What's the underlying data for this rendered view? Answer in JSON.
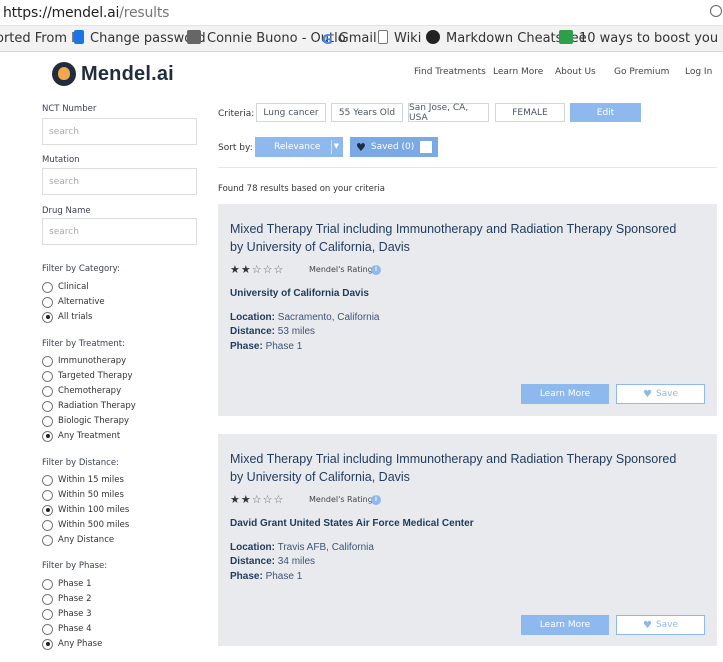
{
  "browser": {
    "url_host": "https://mendel.ai",
    "url_path": "/results",
    "bookmarks": [
      {
        "label": "orted From IE",
        "icon": "none"
      },
      {
        "label": "Change password",
        "icon": "bookmark-blue-icon"
      },
      {
        "label": "Connie Buono - Outlo",
        "icon": "avatar-icon"
      },
      {
        "label": "Gmail",
        "icon": "google-icon"
      },
      {
        "label": "Wiki",
        "icon": "page-icon"
      },
      {
        "label": "Markdown Cheatshee",
        "icon": "github-icon"
      },
      {
        "label": "10 ways to boost you",
        "icon": "green-bookmark-icon"
      }
    ]
  },
  "header": {
    "logo": "Mendel.ai",
    "nav": [
      "Find Treatments",
      "Learn More",
      "About Us",
      "Go Premium",
      "Log In"
    ]
  },
  "sidebar": {
    "nct_label": "NCT Number",
    "nct_placeholder": "search",
    "mutation_label": "Mutation",
    "mutation_placeholder": "search",
    "drug_label": "Drug Name",
    "drug_placeholder": "search",
    "category": {
      "label": "Filter by Category:",
      "options": [
        "Clinical",
        "Alternative",
        "All trials"
      ],
      "selected": "All trials"
    },
    "treatment": {
      "label": "Filter by Treatment:",
      "options": [
        "Immunotherapy",
        "Targeted Therapy",
        "Chemotherapy",
        "Radiation Therapy",
        "Biologic Therapy",
        "Any Treatment"
      ],
      "selected": "Any Treatment"
    },
    "distance": {
      "label": "Filter by Distance:",
      "options": [
        "Within 15 miles",
        "Within 50 miles",
        "Within 100 miles",
        "Within 500 miles",
        "Any Distance"
      ],
      "selected": "Within 100 miles"
    },
    "phase": {
      "label": "Filter by Phase:",
      "options": [
        "Phase 1",
        "Phase 2",
        "Phase 3",
        "Phase 4",
        "Any Phase"
      ],
      "selected": "Any Phase"
    }
  },
  "criteria": {
    "label": "Criteria:",
    "chips": [
      "Lung cancer",
      "55 Years Old",
      "San Jose, CA, USA",
      "FEMALE"
    ],
    "edit_label": "Edit"
  },
  "sort": {
    "label": "Sort by:",
    "selected": "Relevance",
    "saved_label": "Saved (0)"
  },
  "results_summary": "Found 78 results based on your criteria",
  "results": [
    {
      "title": "Mixed Therapy Trial including Immunotherapy and Radiation Therapy Sponsored by University of California, Davis",
      "stars_filled": 2,
      "stars_total": 5,
      "rating_label": "Mendel's Rating",
      "institution": "University of California Davis",
      "location_label": "Location:",
      "location": "Sacramento, California",
      "distance_label": "Distance:",
      "distance": "53 miles",
      "phase_label": "Phase:",
      "phase": "Phase 1",
      "learn_label": "Learn More",
      "save_label": "Save"
    },
    {
      "title": "Mixed Therapy Trial including Immunotherapy and Radiation Therapy Sponsored by University of California, Davis",
      "stars_filled": 2,
      "stars_total": 5,
      "rating_label": "Mendel's Rating",
      "institution": "David Grant United States Air Force Medical Center",
      "location_label": "Location:",
      "location": "Travis AFB, California",
      "distance_label": "Distance:",
      "distance": "34 miles",
      "phase_label": "Phase:",
      "phase": "Phase 1",
      "learn_label": "Learn More",
      "save_label": "Save"
    }
  ],
  "colors": {
    "accent": "#8db9ee",
    "card_bg": "#e9eaee",
    "title": "#1f3a5c"
  }
}
